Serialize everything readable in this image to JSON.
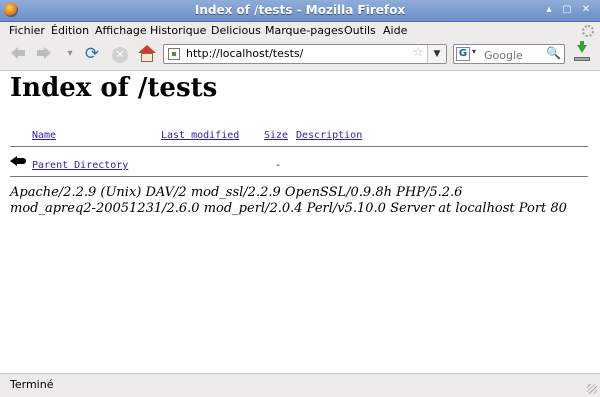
{
  "window": {
    "title": "Index of /tests - Mozilla Firefox",
    "controls": {
      "minimize": "▴",
      "maximize": "▢",
      "close": "✕"
    }
  },
  "menu": {
    "items": [
      {
        "label": "Fichier"
      },
      {
        "label": "Édition"
      },
      {
        "label": "Affichage"
      },
      {
        "label": "Historique"
      },
      {
        "label": "Delicious"
      },
      {
        "label": "Marque-pages"
      },
      {
        "label": "Outils"
      },
      {
        "label": "Aide"
      }
    ]
  },
  "toolbar": {
    "back_icon": "back-arrow-icon",
    "forward_icon": "forward-arrow-icon",
    "history_glyph": "▾",
    "reload_glyph": "⟳",
    "stop_glyph": "✕",
    "url": "http://localhost/tests/",
    "bookmark_star": "☆",
    "url_dropdown": "▼",
    "search_engine_glyph": "G",
    "search_engine_dropdown": "▾",
    "search_placeholder": "Google",
    "search_go_glyph": "🔍"
  },
  "page": {
    "title": "Index of /tests",
    "columns": [
      {
        "label": "Name"
      },
      {
        "label": "Last modified"
      },
      {
        "label": "Size"
      },
      {
        "label": "Description"
      }
    ],
    "rows": [
      {
        "name": "Parent Directory",
        "size": "-"
      }
    ],
    "address": "Apache/2.2.9 (Unix) DAV/2 mod_ssl/2.2.9 OpenSSL/0.9.8h PHP/5.2.6\nmod_apreq2-20051231/2.6.0 mod_perl/2.0.4 Perl/v5.10.0 Server at localhost Port 80"
  },
  "status": {
    "text": "Terminé"
  },
  "colors": {
    "titlebar": "#7b9bd0",
    "chrome": "#edeceb",
    "link": "#2a1fb5"
  }
}
